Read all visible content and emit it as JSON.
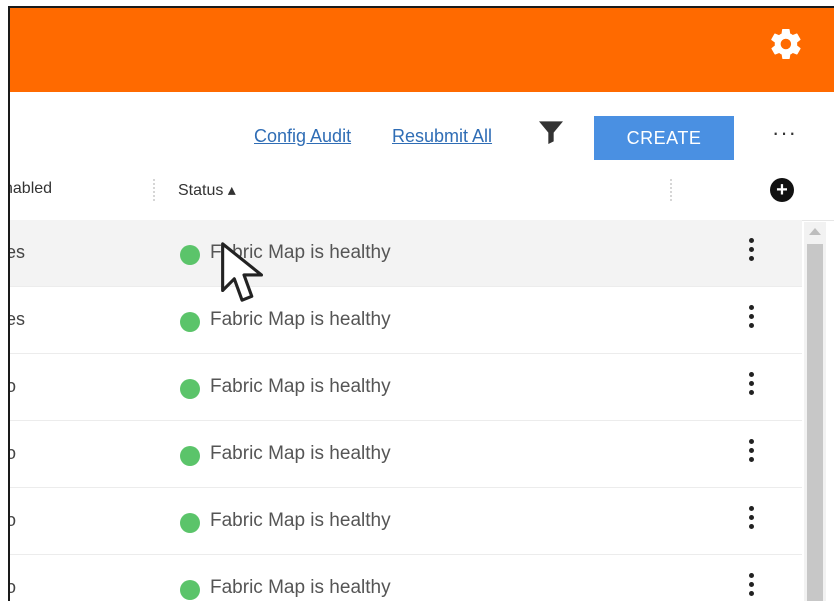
{
  "colors": {
    "topbar": "#ff6a00",
    "link": "#2f6db5",
    "create": "#4a90e2",
    "status_healthy": "#5bc46a"
  },
  "toolbar": {
    "config_audit": "Config Audit",
    "resubmit_all": "Resubmit All",
    "create_label": "CREATE",
    "more_label": "···"
  },
  "header": {
    "enabled": "nabled",
    "status": "Status ▴"
  },
  "rows": [
    {
      "enabled": "es",
      "status": "Fabric Map is healthy"
    },
    {
      "enabled": "es",
      "status": "Fabric Map is healthy"
    },
    {
      "enabled": "o",
      "status": "Fabric Map is healthy"
    },
    {
      "enabled": "o",
      "status": "Fabric Map is healthy"
    },
    {
      "enabled": "o",
      "status": "Fabric Map is healthy"
    },
    {
      "enabled": "o",
      "status": "Fabric Map is healthy"
    }
  ],
  "icons": [
    "settings-gear-icon",
    "filter-icon",
    "add-column-icon",
    "kebab-menu-icon",
    "mouse-pointer-icon"
  ]
}
